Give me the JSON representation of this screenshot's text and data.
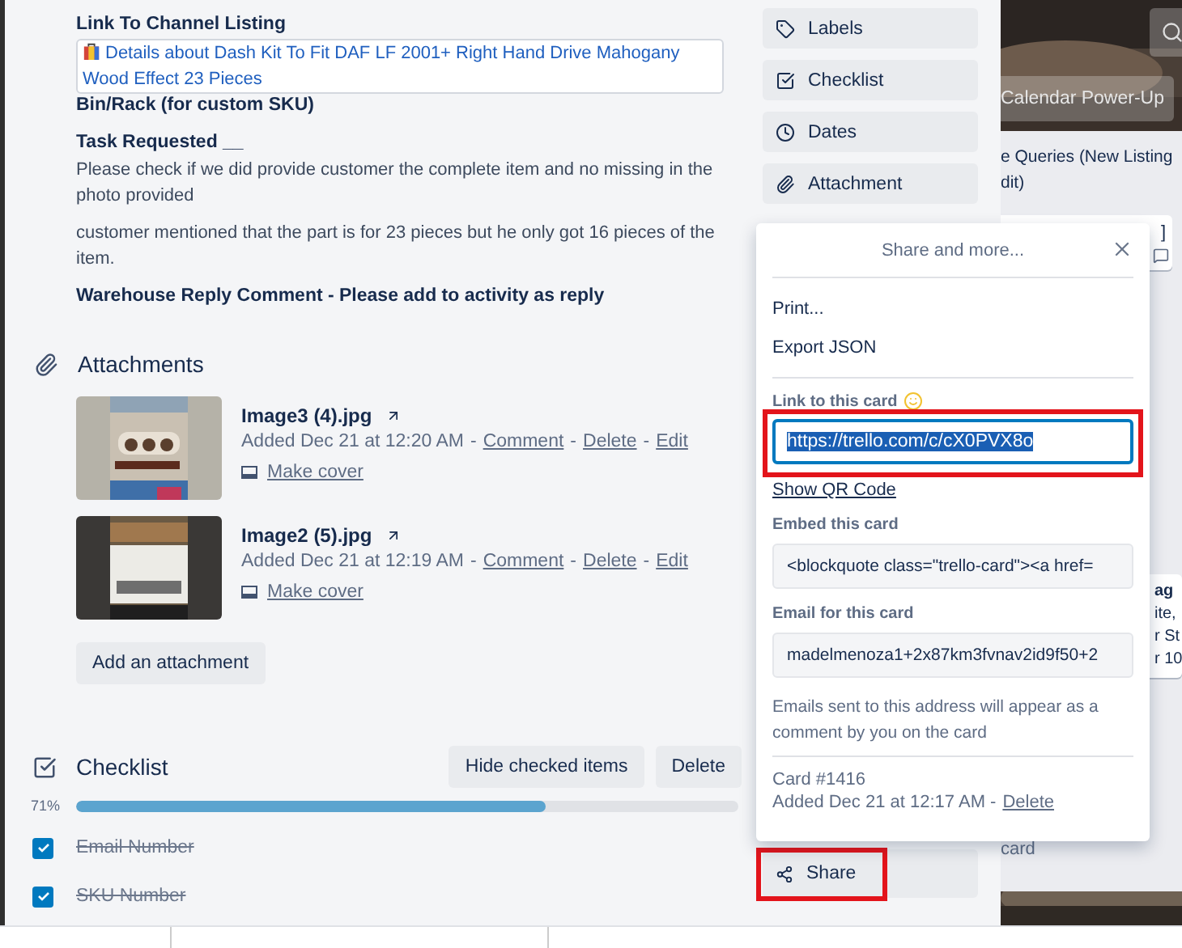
{
  "description": {
    "blocks": [
      {
        "kind": "heading",
        "text": "Link To Channel Listing"
      },
      {
        "kind": "link",
        "text": "Details about  Dash Kit To Fit DAF LF 2001+ Right Hand Drive Mahogany Wood Effect 23 Pieces"
      },
      {
        "kind": "heading",
        "text": "Bin/Rack (for custom SKU)"
      },
      {
        "kind": "heading",
        "text": "Task Requested __"
      },
      {
        "kind": "paragraph",
        "text": "Please check if we did provide customer the complete item and no missing in the photo provided"
      },
      {
        "kind": "paragraph",
        "text": "customer mentioned that the part is for 23 pieces but he only got 16 pieces of the item."
      },
      {
        "kind": "heading",
        "text": "Warehouse Reply Comment - Please add to activity as reply"
      }
    ]
  },
  "attachments": {
    "title": "Attachments",
    "items": [
      {
        "name": "Image3 (4).jpg",
        "added": "Added Dec 21 at 12:20 AM",
        "actions": [
          {
            "sep": "-",
            "label": "Comment"
          },
          {
            "sep": "-",
            "label": "Delete"
          },
          {
            "sep": "-",
            "label": "Edit"
          }
        ],
        "make_cover": "Make cover"
      },
      {
        "name": "Image2 (5).jpg",
        "added": "Added Dec 21 at 12:19 AM",
        "actions": [
          {
            "sep": "-",
            "label": "Comment"
          },
          {
            "sep": "-",
            "label": "Delete"
          },
          {
            "sep": "-",
            "label": "Edit"
          }
        ],
        "make_cover": "Make cover"
      }
    ],
    "add_button": "Add an attachment"
  },
  "checklist": {
    "title": "Checklist",
    "buttons": [
      "Hide checked items",
      "Delete"
    ],
    "percent": "71%",
    "level": 0.71,
    "items": [
      {
        "text": "Email Number",
        "checked": true
      },
      {
        "text": "SKU Number",
        "checked": true
      }
    ]
  },
  "sidebar": {
    "items": [
      {
        "kind": "tag",
        "label": "Labels"
      },
      {
        "kind": "checklist",
        "label": "Checklist"
      },
      {
        "kind": "clock",
        "label": "Dates"
      },
      {
        "kind": "paperclip",
        "label": "Attachment"
      }
    ],
    "share": {
      "label": "Share",
      "highlighted": true
    }
  },
  "popup": {
    "title": "Share and more...",
    "menu": [
      "Print...",
      "Export JSON"
    ],
    "link": {
      "label": "Link to this card",
      "value": "https://trello.com/c/cX0PVX8o",
      "selected": true,
      "highlighted": true
    },
    "qr_link": "Show QR Code",
    "embed": {
      "label": "Embed this card",
      "value": "<blockquote class=\"trello-card\"><a href="
    },
    "email": {
      "label": "Email for this card",
      "value": "madelmenoza1+2x87km3fvnav2id9f50+2",
      "note": "Emails sent to this address will appear as a comment by you on the card"
    },
    "footer": {
      "card_number": "Card #1416",
      "added": "Added Dec 21 at 12:17 AM -",
      "delete": "Delete"
    }
  },
  "board": {
    "header_button": "Calendar Power-Up",
    "list_title": [
      "e Queries (New Listing",
      "dit)"
    ],
    "card_a": [
      "]"
    ],
    "card_b": [
      "ag",
      "ite,",
      "r St",
      "r 10"
    ],
    "add_card": "card"
  }
}
